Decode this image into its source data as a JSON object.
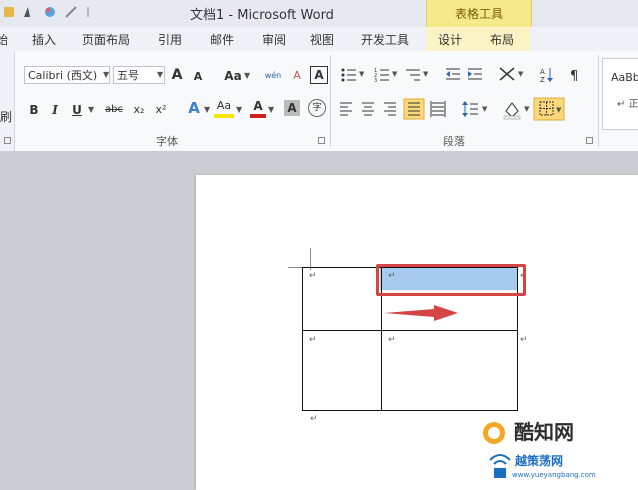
{
  "window": {
    "title": "文档1 - Microsoft Word"
  },
  "context_group": {
    "label": "表格工具"
  },
  "tabs": [
    {
      "label": "插入"
    },
    {
      "label": "页面布局"
    },
    {
      "label": "引用"
    },
    {
      "label": "邮件"
    },
    {
      "label": "审阅"
    },
    {
      "label": "视图"
    },
    {
      "label": "开发工具"
    },
    {
      "label": "设计"
    },
    {
      "label": "布局"
    }
  ],
  "left_strip": {
    "tab_fragment": "始",
    "clip_fragment": "刷"
  },
  "font": {
    "name": "Calibri (西文)",
    "size": "五号",
    "group_label": "字体",
    "buttons": {
      "bold": "B",
      "italic": "I",
      "underline": "U",
      "strike": "abc",
      "subscript": "x₂",
      "superscript": "x²",
      "grow": "A",
      "shrink": "A",
      "change_case": "Aa",
      "pinyin": "wén",
      "clear": "A",
      "font_color": "A",
      "char_shade": "A",
      "enclose": "字"
    }
  },
  "paragraph": {
    "group_label": "段落"
  },
  "styles": {
    "sample": "AaBb",
    "sub": "↵ 正"
  },
  "document": {
    "paragraph_mark": "↵",
    "selected_cell": "row1-col2"
  },
  "watermark": {
    "brand": "酷知网",
    "site_cn": "越策荡网",
    "site_url": "www.yueyangbang.com"
  },
  "colors": {
    "accent_context": "#f5e98a",
    "selection": "#a6c9ee",
    "annotation_red": "#d64545"
  }
}
